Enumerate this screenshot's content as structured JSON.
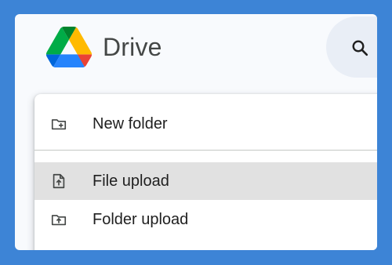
{
  "header": {
    "brand": "Drive",
    "logo_icon": "google-drive-logo",
    "search_icon": "search-icon"
  },
  "menu": {
    "items": [
      {
        "label": "New folder",
        "icon": "folder-add-icon"
      },
      {
        "label": "File upload",
        "icon": "file-upload-icon",
        "highlighted": true
      },
      {
        "label": "Folder upload",
        "icon": "folder-upload-icon"
      }
    ]
  },
  "colors": {
    "frame": "#3d84d6",
    "surface": "#f8fafd",
    "search_bg": "#e9eef6",
    "hover": "#e1e1e1",
    "drive_green": "#0f9d58",
    "drive_blue": "#4285f4",
    "drive_yellow": "#f4b400",
    "drive_red": "#db4437"
  }
}
